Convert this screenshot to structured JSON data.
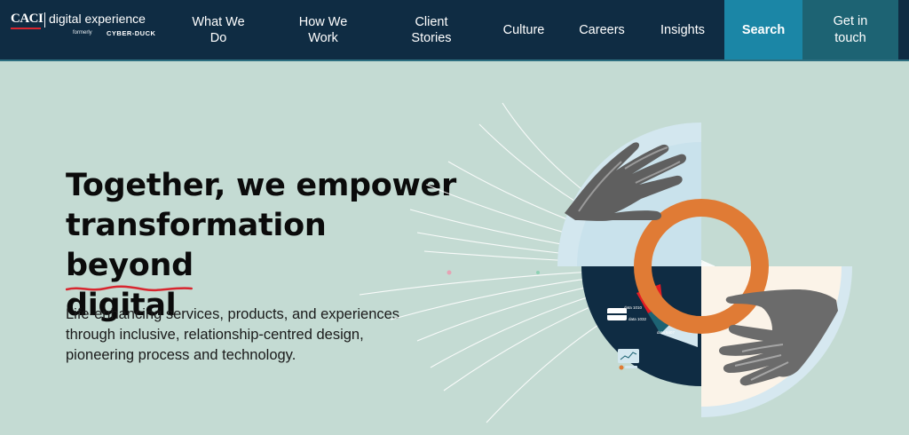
{
  "nav": {
    "logo": {
      "brand": "CACI",
      "product": "digital experience",
      "formerly": "formerly",
      "former_name": "CYBER-DUCK"
    },
    "items": [
      {
        "line1": "What We",
        "line2": "Do"
      },
      {
        "line1": "How We",
        "line2": "Work"
      },
      {
        "line1": "Client",
        "line2": "Stories"
      },
      {
        "line1": "Culture",
        "line2": ""
      },
      {
        "line1": "Careers",
        "line2": ""
      },
      {
        "line1": "Insights",
        "line2": ""
      }
    ],
    "search_label": "Search",
    "cta": {
      "line1": "Get in",
      "line2": "touch"
    }
  },
  "hero": {
    "headline_line1": "Together, we empower",
    "headline_line2_a": "transformation ",
    "headline_line2_b": "beyond",
    "headline_line3": "digital",
    "subtext_line1": "Life-enhancing services, products, and experiences",
    "subtext_line2": "through inclusive, relationship-centred design,",
    "subtext_line3": "pioneering process and technology."
  },
  "illustration": {
    "labels": [
      "data 1010",
      "data 1032",
      "data 5407"
    ]
  },
  "colors": {
    "nav_bg": "#0f2c43",
    "search_bg": "#1b86a6",
    "cta_bg": "#1d6373",
    "hero_bg": "#c4dbd3",
    "ring_orange": "#e07b35",
    "accent_red": "#d8262f"
  }
}
